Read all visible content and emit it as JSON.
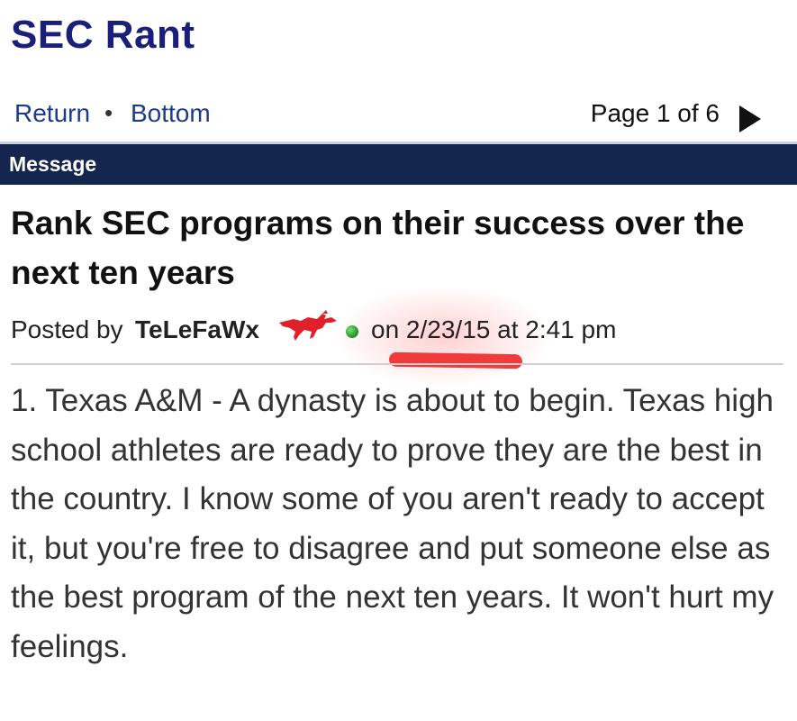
{
  "board": {
    "title": "SEC Rant"
  },
  "nav": {
    "return_label": "Return",
    "separator": "•",
    "bottom_label": "Bottom",
    "page_indicator": "Page 1 of 6"
  },
  "header": {
    "label": "Message"
  },
  "thread": {
    "title": "Rank SEC programs on their success over the next ten years"
  },
  "post": {
    "posted_by_prefix": "Posted by",
    "username": "TeLeFaWx",
    "date_text": "on 2/23/15 at 2:41 pm",
    "body": "1. Texas A&M - A dynasty is about to begin. Texas high school athletes are ready to prove they are the best in the country. I know some of you aren't ready to accept it, but you're free to disagree and put someone else as the best program of the next ten years. It won't hurt my feelings."
  },
  "icons": {
    "next_page": "triangle-right-icon",
    "team_logo": "mustang-icon",
    "online_status": "green-dot-icon"
  },
  "colors": {
    "brand": "#1c1f7a",
    "header_bar": "#14264d",
    "link": "#1c3c8a",
    "annotation_red": "#ef3b3b"
  }
}
